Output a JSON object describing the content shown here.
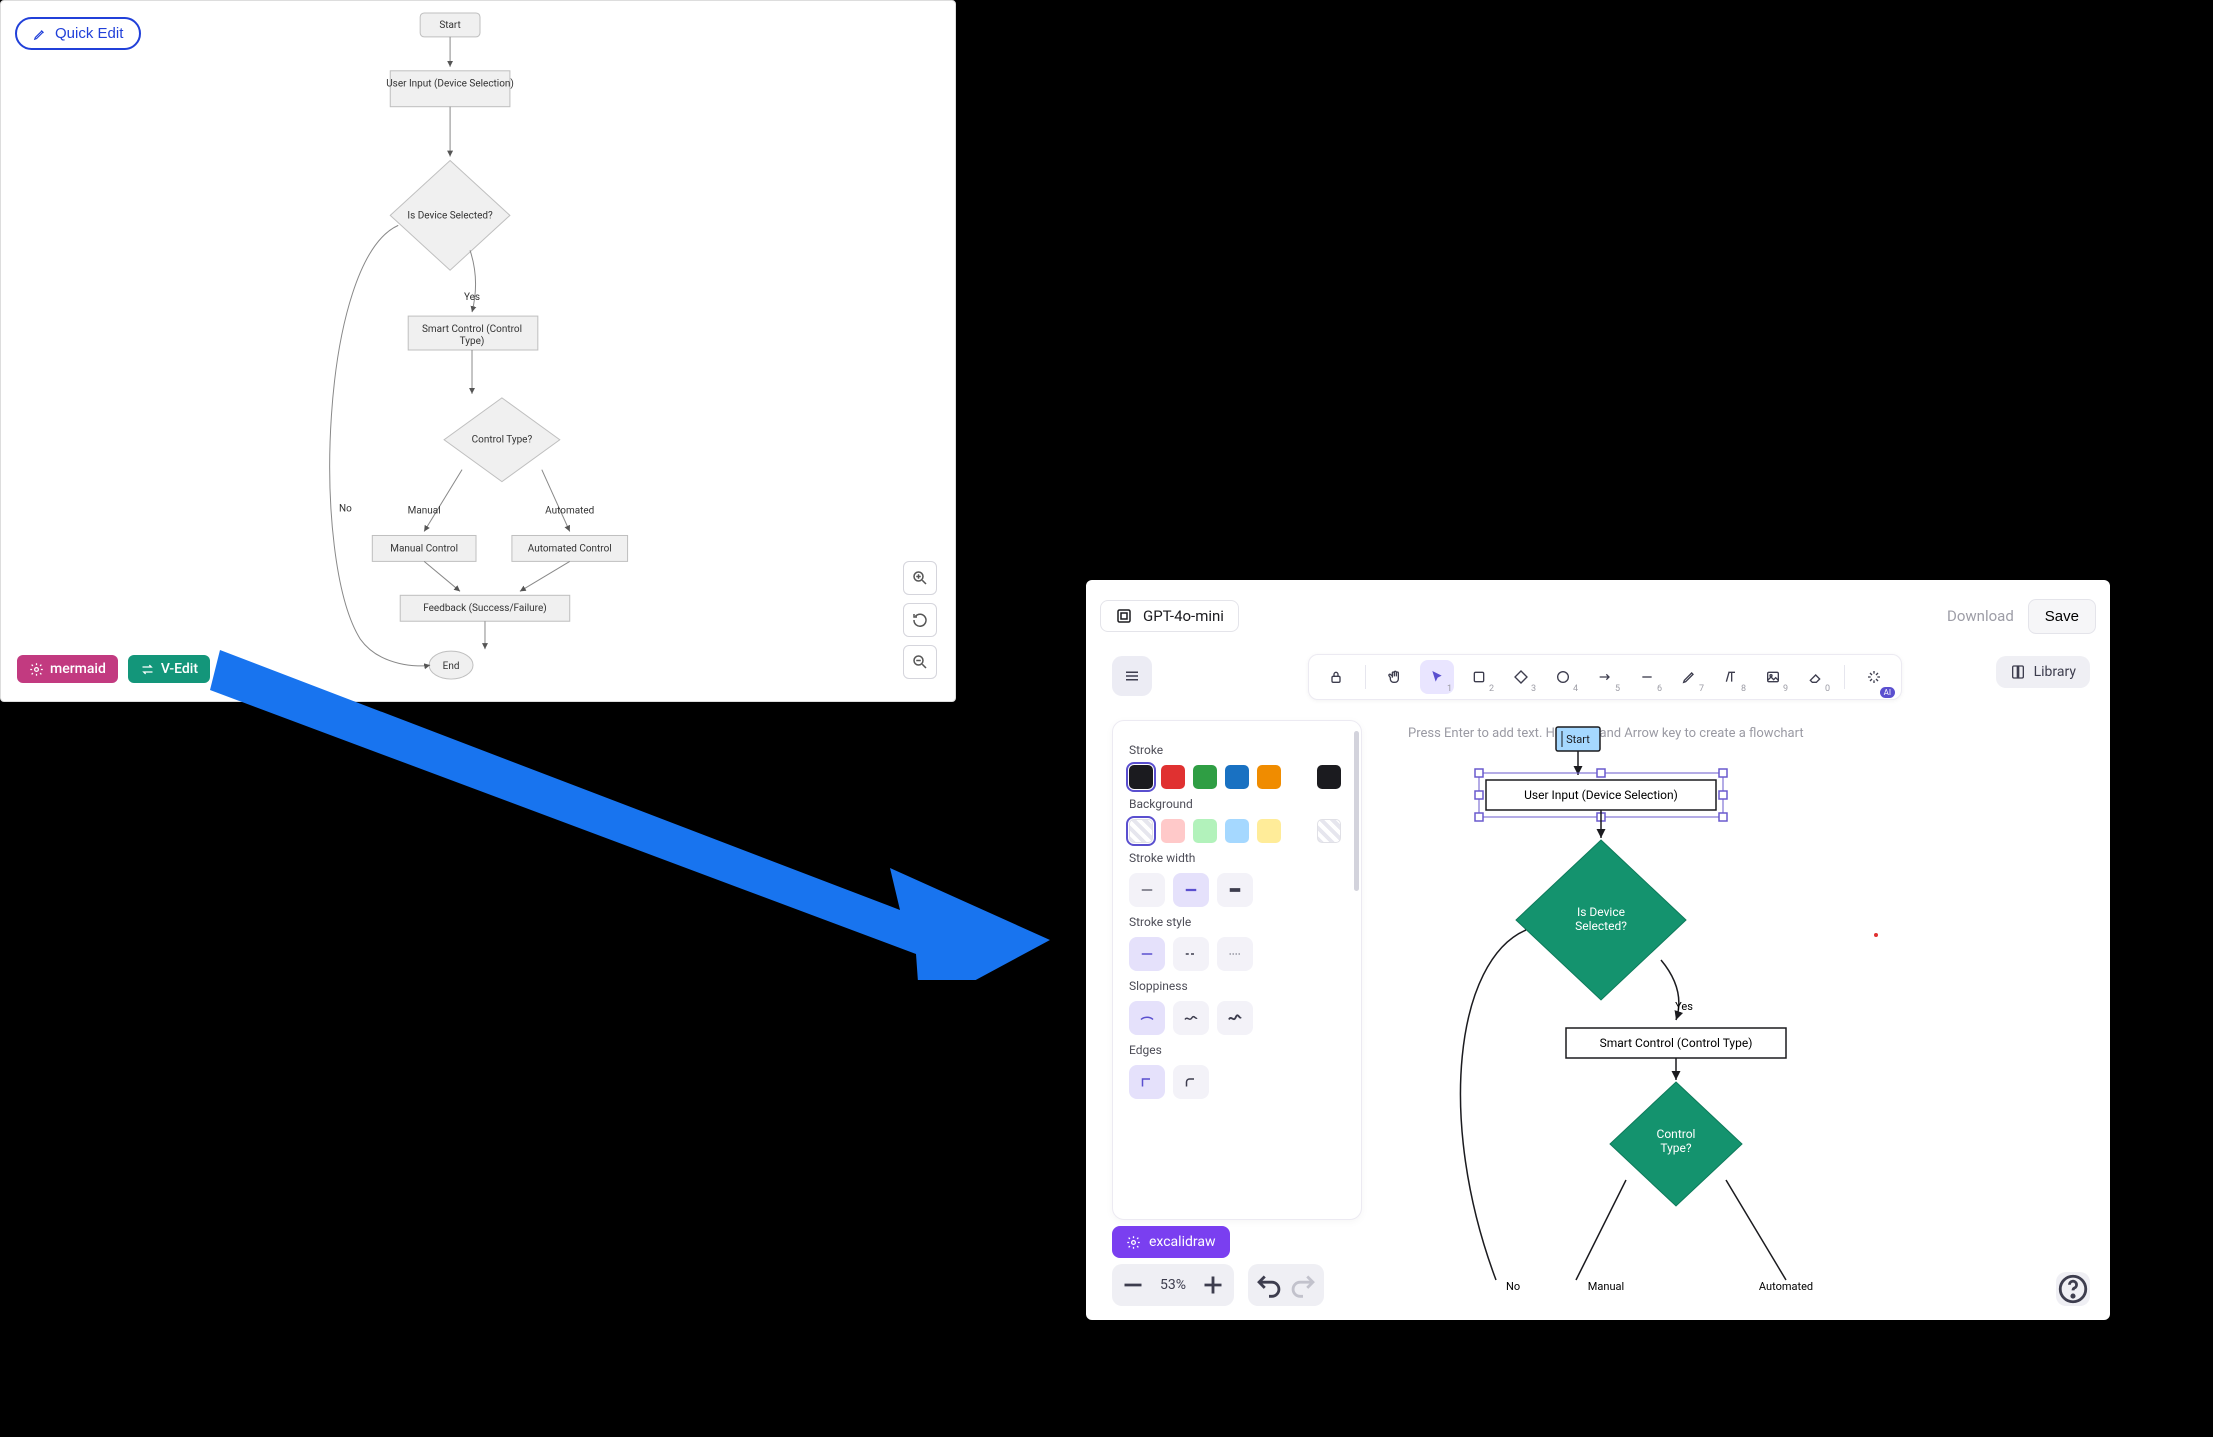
{
  "panelA": {
    "quick_edit_label": "Quick Edit",
    "badge_mermaid": "mermaid",
    "badge_vedit": "V-Edit",
    "flow": {
      "start": "Start",
      "user_input": "User Input (Device Selection)",
      "is_selected": "Is Device Selected?",
      "yes": "Yes",
      "no": "No",
      "smart_control": "Smart Control (Control Type)",
      "control_type": "Control Type?",
      "manual_lbl": "Manual",
      "automated_lbl": "Automated",
      "manual_ctrl": "Manual Control",
      "automated_ctrl": "Automated Control",
      "feedback": "Feedback (Success/Failure)",
      "end": "End"
    }
  },
  "panelB": {
    "model": "GPT-4o-mini",
    "download": "Download",
    "save": "Save",
    "library": "Library",
    "hint": "Press Enter to add text. Hold Ctrl and Arrow key to create a flowchart",
    "zoom_pct": "53%",
    "tools": {
      "lock": "lock",
      "hand": "hand",
      "select": "select",
      "rect": "rectangle",
      "diamond": "diamond",
      "ellipse": "ellipse",
      "arrow": "arrow",
      "line": "line",
      "draw": "draw",
      "text": "text",
      "image": "image",
      "eraser": "eraser",
      "ai": "ai"
    },
    "tool_idx": {
      "select": "1",
      "rect": "2",
      "diamond": "3",
      "ellipse": "4",
      "arrow": "5",
      "line": "6",
      "draw": "7",
      "text": "8",
      "image": "9",
      "eraser": "0"
    },
    "side": {
      "stroke_label": "Stroke",
      "stroke_colors": [
        "#1b1b1f",
        "#e03131",
        "#2f9e44",
        "#1971c2",
        "#f08c00"
      ],
      "stroke_custom": "#1b1b1f",
      "bg_label": "Background",
      "bg_colors": [
        "transparent",
        "#ffc9c9",
        "#b2f2bb",
        "#a5d8ff",
        "#ffec99"
      ],
      "bg_custom": "transparent",
      "stroke_width_label": "Stroke width",
      "stroke_style_label": "Stroke style",
      "sloppiness_label": "Sloppiness",
      "edges_label": "Edges"
    },
    "excalidraw_label": "excalidraw",
    "flow": {
      "start": "Start",
      "user_input": "User Input (Device Selection)",
      "is_selected": "Is Device Selected?",
      "yes": "Yes",
      "smart_control": "Smart Control (Control Type)",
      "control_type": "Control Type?",
      "no": "No",
      "manual": "Manual",
      "automated": "Automated"
    }
  }
}
